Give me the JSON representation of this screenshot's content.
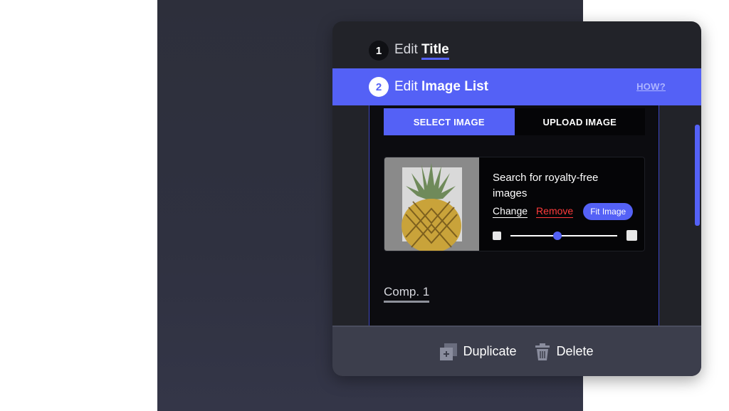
{
  "step1": {
    "number": "1",
    "prefix": "Edit",
    "name": "Title"
  },
  "step2": {
    "number": "2",
    "prefix": "Edit",
    "name": "Image List",
    "help_link": "HOW?"
  },
  "tabs": [
    {
      "label": "SELECT IMAGE",
      "active": true
    },
    {
      "label": "UPLOAD IMAGE",
      "active": false
    }
  ],
  "image_card": {
    "description": "Search for royalty-free images",
    "change_label": "Change",
    "remove_label": "Remove",
    "fit_label": "Fit Image",
    "zoom_level_fraction": 0.44,
    "icons": {
      "zoom_out": "small-image-icon",
      "zoom_in": "large-image-icon"
    }
  },
  "component_label": "Comp. 1",
  "footer": {
    "duplicate_label": "Duplicate",
    "delete_label": "Delete"
  },
  "colors": {
    "accent": "#5461f6",
    "danger": "#ff3b3b",
    "card_bg": "#222329",
    "panel_bg": "#0c0c10"
  }
}
